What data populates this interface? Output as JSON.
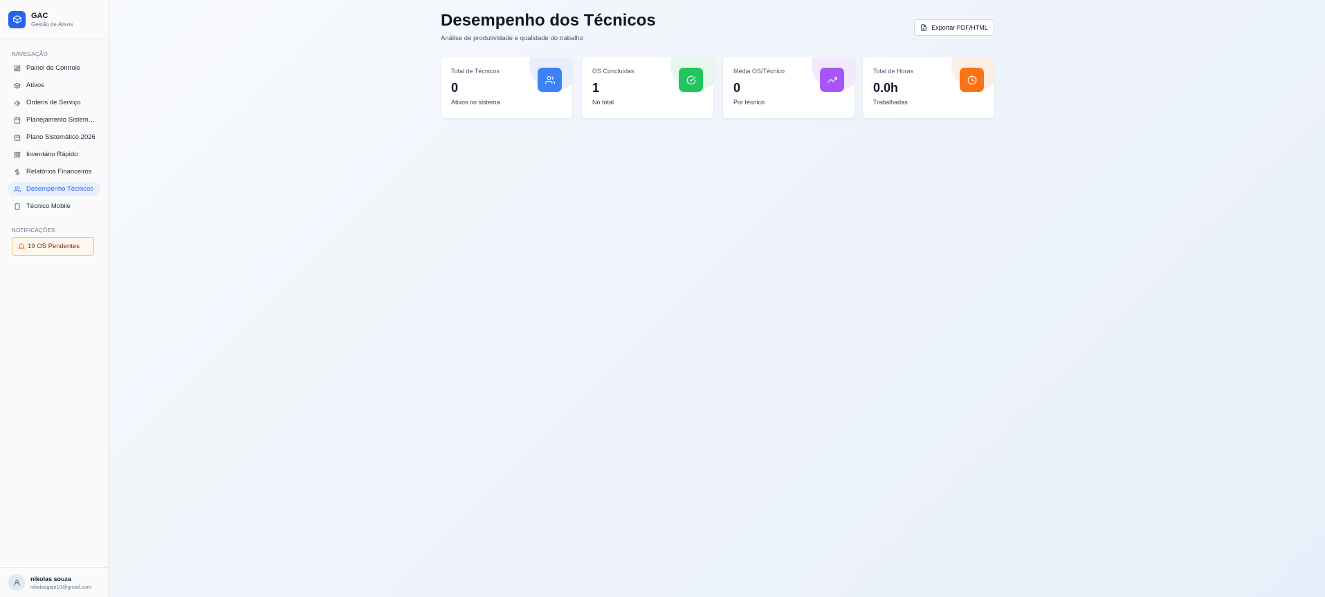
{
  "brand": {
    "name": "GAC",
    "subtitle": "Gestão de Ativos",
    "icon": "box-icon"
  },
  "sidebar": {
    "nav_label": "NAVEGAÇÃO",
    "items": [
      {
        "label": "Painel de Controle",
        "icon": "dashboard-icon"
      },
      {
        "label": "Ativos",
        "icon": "box-icon"
      },
      {
        "label": "Ordens de Serviço",
        "icon": "wrench-icon"
      },
      {
        "label": "Planejamento Sistemá...",
        "icon": "calendar-icon"
      },
      {
        "label": "Plano Sistemático 2026",
        "icon": "calendar-icon"
      },
      {
        "label": "Inventário Rápido",
        "icon": "qr-code-icon"
      },
      {
        "label": "Relatórios Financeiros",
        "icon": "dollar-icon"
      },
      {
        "label": "Desempenho Técnicos",
        "icon": "users-icon",
        "active": true
      },
      {
        "label": "Técnico Mobile",
        "icon": "smartphone-icon"
      }
    ],
    "notifications_label": "NOTIFICAÇÕES",
    "notification": {
      "label": "19 OS Pendentes",
      "icon": "bell-icon"
    }
  },
  "user": {
    "name": "nikolas souza",
    "email": "nikolasgian10@gmail.com"
  },
  "header": {
    "title": "Desempenho dos Técnicos",
    "subtitle": "Análise de produtividade e qualidade do trabalho",
    "export_label": "Exportar PDF/HTML"
  },
  "cards": [
    {
      "label": "Total de Técnicos",
      "value": "0",
      "sub": "Ativos no sistema",
      "icon": "users-icon",
      "color": "#3b82f6",
      "blob": "#e8eefc"
    },
    {
      "label": "OS Concluídas",
      "value": "1",
      "sub": "No total",
      "icon": "check-circle-icon",
      "color": "#22c55e",
      "blob": "#e7f7ed"
    },
    {
      "label": "Média OS/Técnico",
      "value": "0",
      "sub": "Por técnico",
      "icon": "trending-up-icon",
      "color": "#a855f7",
      "blob": "#f3e9fd"
    },
    {
      "label": "Total de Horas",
      "value": "0.0h",
      "sub": "Trabalhadas",
      "icon": "clock-icon",
      "color": "#f97316",
      "blob": "#fdeee3"
    }
  ]
}
